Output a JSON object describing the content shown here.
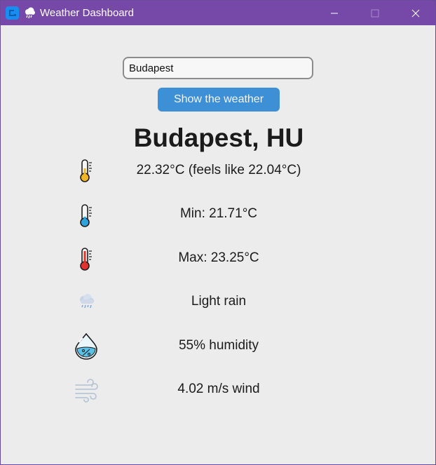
{
  "window": {
    "title": "Weather Dashboard"
  },
  "search": {
    "value": "Budapest",
    "button_label": "Show the weather"
  },
  "location": "Budapest, HU",
  "conditions": {
    "temperature": "22.32°C (feels like 22.04°C)",
    "min": "Min: 21.71°C",
    "max": "Max: 23.25°C",
    "description": "Light rain",
    "humidity": "55% humidity",
    "wind": "4.02 m/s wind"
  },
  "icons": {
    "app": "app-logo-icon",
    "title_weather": "rain-cloud-icon",
    "temperature": "thermometer-icon",
    "min": "thermometer-cold-icon",
    "max": "thermometer-hot-icon",
    "description": "light-rain-icon",
    "humidity": "humidity-drop-icon",
    "wind": "wind-icon"
  },
  "colors": {
    "titlebar": "#7649a8",
    "button": "#3d8fd6",
    "background": "#ececec"
  }
}
